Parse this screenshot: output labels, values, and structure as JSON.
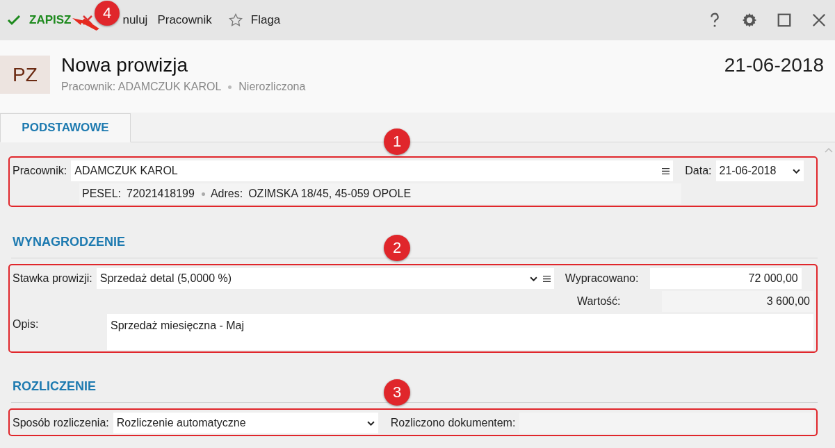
{
  "toolbar": {
    "items": [
      {
        "kind": "save",
        "label": "ZAPISZ"
      },
      {
        "kind": "cancel",
        "label": "nuluj"
      },
      {
        "kind": "plain",
        "label": "Pracownik"
      },
      {
        "kind": "flag",
        "label": "Flaga"
      }
    ],
    "annotation": "4"
  },
  "header": {
    "avatar": "PZ",
    "title": "Nowa prowizja",
    "subtitle": [
      "Pracownik: ADAMCZUK KAROL",
      "Nierozliczona"
    ],
    "date": "21-06-2018"
  },
  "tabs": [
    {
      "label": "PODSTAWOWE",
      "selected": true
    }
  ],
  "basic": {
    "annotation": "1",
    "employee_label": "Pracownik:",
    "employee": "ADAMCZUK KAROL",
    "pesel_label": "PESEL:",
    "pesel": "72021418199",
    "address_label": "Adres:",
    "address": "OZIMSKA 18/45, 45-059 OPOLE",
    "date_label": "Data:",
    "date": "21-06-2018"
  },
  "salary": {
    "heading": "WYNAGRODZENIE",
    "annotation": "2",
    "rate_label": "Stawka prowizji:",
    "rate": "Sprzedaż detal (5,0000 %)",
    "worked_label": "Wypracowano:",
    "worked": "72 000,00",
    "value_label": "Wartość:",
    "value": "3 600,00",
    "description_label": "Opis:",
    "description": "Sprzedaż miesięczna - Maj"
  },
  "settlement": {
    "heading": "ROZLICZENIE",
    "annotation": "3",
    "method_label": "Sposób rozliczenia:",
    "method": "Rozliczenie automatyczne",
    "document_label": "Rozliczono dokumentem:"
  }
}
